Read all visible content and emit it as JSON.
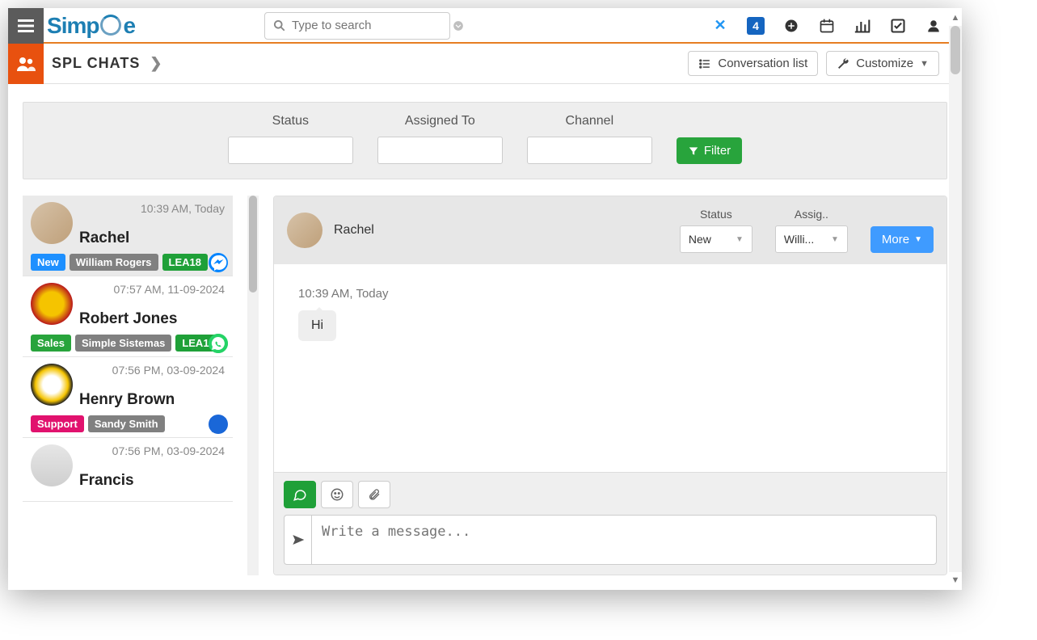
{
  "topbar": {
    "search_placeholder": "Type to search",
    "logo_text_left": "S",
    "logo_text_mid": "mp",
    "logo_text_right": "e",
    "icon_4": "4"
  },
  "subheader": {
    "title": "SPL CHATS",
    "conversation_list": "Conversation list",
    "customize": "Customize"
  },
  "filters": {
    "status_label": "Status",
    "assigned_label": "Assigned To",
    "channel_label": "Channel",
    "filter_btn": "Filter"
  },
  "conversations": [
    {
      "time": "10:39 AM, Today",
      "name": "Rachel",
      "badges": [
        {
          "text": "New",
          "cls": "b-blue"
        },
        {
          "text": "William Rogers",
          "cls": "b-gray"
        },
        {
          "text": "LEA18",
          "cls": "b-green"
        }
      ],
      "channel": "messenger",
      "avatar": "",
      "active": true
    },
    {
      "time": "07:57 AM, 11-09-2024",
      "name": "Robert Jones",
      "badges": [
        {
          "text": "Sales",
          "cls": "b-greenlt"
        },
        {
          "text": "Simple Sistemas",
          "cls": "b-gray"
        },
        {
          "text": "LEA17",
          "cls": "b-green"
        }
      ],
      "channel": "whatsapp",
      "avatar": "orange",
      "active": false
    },
    {
      "time": "07:56 PM, 03-09-2024",
      "name": "Henry Brown",
      "badges": [
        {
          "text": "Support",
          "cls": "b-pink"
        },
        {
          "text": "Sandy Smith",
          "cls": "b-gray"
        }
      ],
      "channel": "sms",
      "avatar": "yellow",
      "active": false
    },
    {
      "time": "07:56 PM, 03-09-2024",
      "name": "Francis",
      "badges": [],
      "channel": "",
      "avatar": "photo",
      "active": false
    }
  ],
  "chat": {
    "contact_name": "Rachel",
    "status_label": "Status",
    "status_value": "New",
    "assigned_label": "Assig..",
    "assigned_value": "Willi...",
    "more_btn": "More",
    "msg_time": "10:39 AM, Today",
    "msg_text": "Hi",
    "compose_placeholder": "Write a message..."
  }
}
